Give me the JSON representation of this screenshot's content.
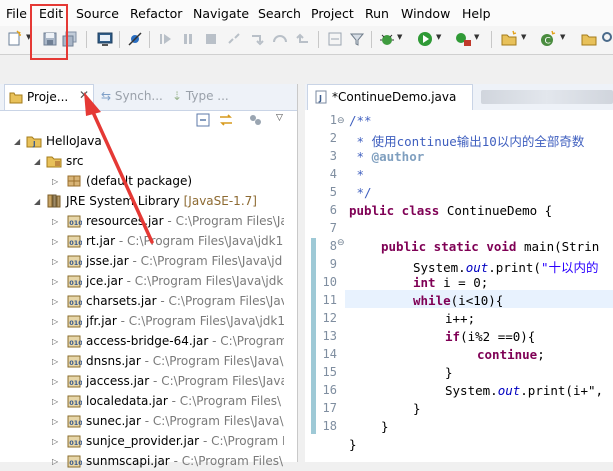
{
  "menubar": [
    "File",
    "Edit",
    "Source",
    "Refactor",
    "Navigate",
    "Search",
    "Project",
    "Run",
    "Window",
    "Help"
  ],
  "colors": {
    "highlight": "#e53935",
    "keyword": "#7f0055",
    "comment": "#3f5fbf",
    "string": "#2a00ff",
    "field": "#0000c0"
  },
  "left_view": {
    "tabs": {
      "active": "Proje...",
      "synch": "Synch...",
      "type": "Type ..."
    },
    "tree": [
      {
        "label": "HelloJava",
        "extra": ""
      },
      {
        "label": "src",
        "extra": ""
      },
      {
        "label": "(default package)",
        "extra": ""
      },
      {
        "label": "JRE System Library",
        "extra": "[JavaSE-1.7]"
      },
      {
        "label": "resources.jar",
        "extra": "- C:\\Program Files\\Ja"
      },
      {
        "label": "rt.jar",
        "extra": "- C:\\Program Files\\Java\\jdk1"
      },
      {
        "label": "jsse.jar",
        "extra": "- C:\\Program Files\\Java\\jd"
      },
      {
        "label": "jce.jar",
        "extra": "- C:\\Program Files\\Java\\jdk"
      },
      {
        "label": "charsets.jar",
        "extra": "- C:\\Program Files\\Jav"
      },
      {
        "label": "jfr.jar",
        "extra": "- C:\\Program Files\\Java\\jdk1"
      },
      {
        "label": "access-bridge-64.jar",
        "extra": "- C:\\Program"
      },
      {
        "label": "dnsns.jar",
        "extra": "- C:\\Program Files\\Java\\"
      },
      {
        "label": "jaccess.jar",
        "extra": "- C:\\Program Files\\Java"
      },
      {
        "label": "localedata.jar",
        "extra": "- C:\\Program Files\\"
      },
      {
        "label": "sunec.jar",
        "extra": "- C:\\Program Files\\Java\\"
      },
      {
        "label": "sunjce_provider.jar",
        "extra": "- C:\\Program Fi"
      },
      {
        "label": "sunmscapi.jar",
        "extra": "- C:\\Program Files\\"
      }
    ]
  },
  "editor": {
    "tab_label": "*ContinueDemo.java",
    "line_numbers": [
      "1",
      "2",
      "3",
      "4",
      "5",
      "6",
      "7",
      "8",
      "9",
      "10",
      "11",
      "12",
      "13",
      "14",
      "15",
      "16",
      "17",
      "18"
    ],
    "code": {
      "l1": "/**",
      "l2": " * 使用continue输出10以内的全部奇数",
      "l3_prefix": " * ",
      "l3_tag": "@author",
      "l4": " *",
      "l5": " */",
      "l6_kw": "public class",
      "l6_rest": " ContinueDemo {",
      "l8_kw": "public static void",
      "l8_rest": " main(Strin",
      "l9_a": "System.",
      "l9_field": "out",
      "l9_b": ".print(",
      "l9_str": "\"十以内的",
      "l10_kw": "int",
      "l10_rest": " i = 0;",
      "l11_kw": "while",
      "l11_rest": "(i<10){",
      "l12": "i++;",
      "l13_kw": "if",
      "l13_rest": "(i%2 ==0){",
      "l14_kw": "continue",
      "l14_rest": ";",
      "l15": "}",
      "l16_a": "System.",
      "l16_field": "out",
      "l16_b": ".print(i+\",",
      "l17": "}",
      "l18": "}",
      "l19": "}"
    }
  }
}
